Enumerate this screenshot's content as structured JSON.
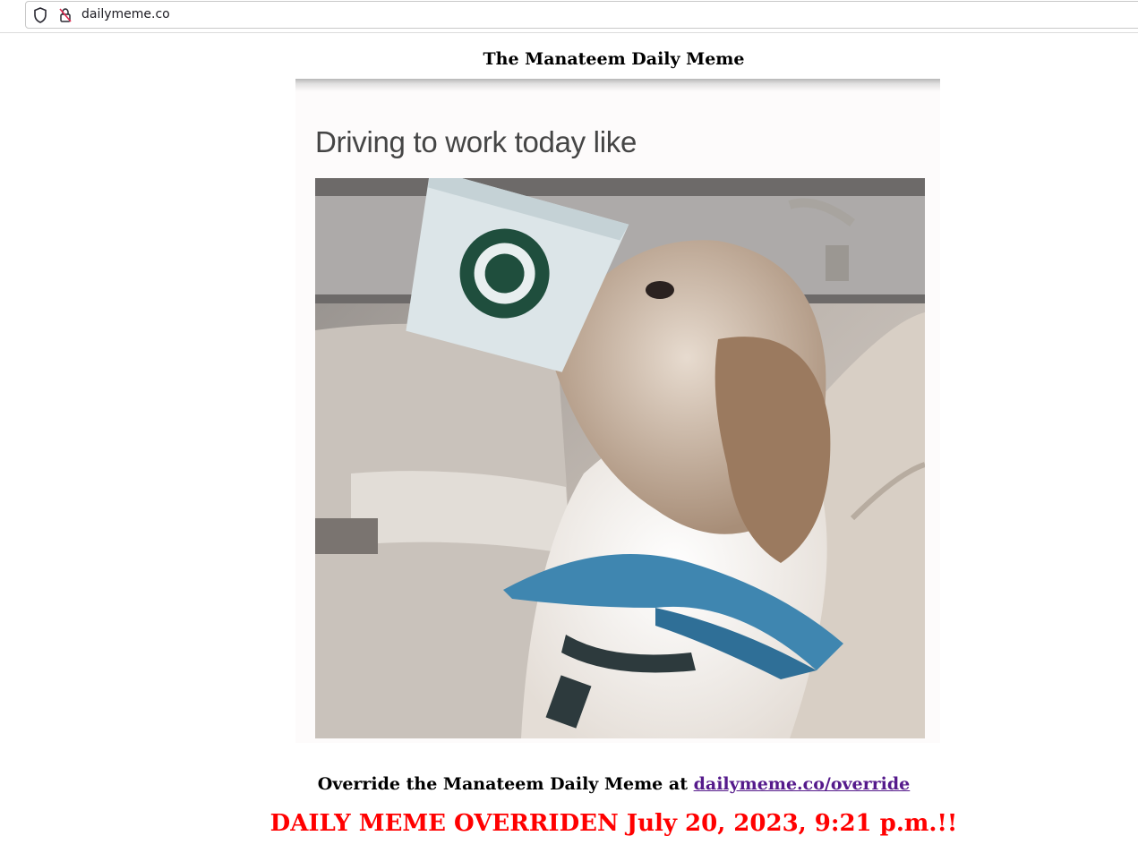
{
  "browser": {
    "url": "dailymeme.co",
    "icons": [
      "shield-icon",
      "lock-icon"
    ]
  },
  "page": {
    "title": "The Manateem Daily Meme",
    "meme": {
      "caption": "Driving to work today like",
      "image": "dog-with-starbucks-cup-on-snout-in-car"
    },
    "override": {
      "text": "Override the Manateem Daily Meme at ",
      "link_text": "dailymeme.co/override"
    },
    "status": "DAILY MEME OVERRIDEN July 20, 2023, 9:21 p.m.!!"
  },
  "colors": {
    "link": "#551a8b",
    "status": "#ff0000"
  }
}
